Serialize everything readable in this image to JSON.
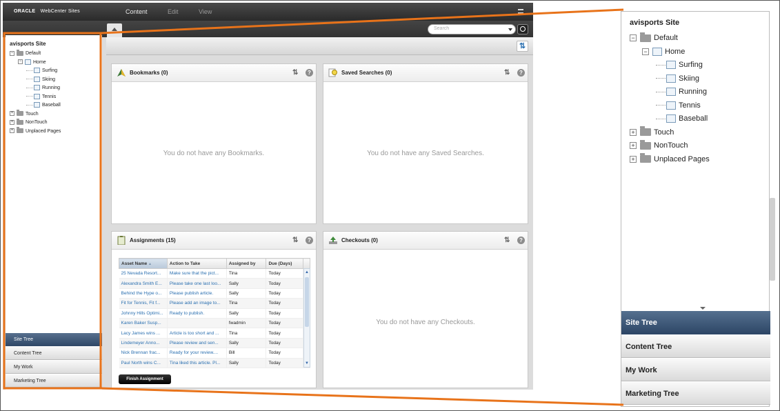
{
  "header": {
    "brand_oracle": "ORACLE",
    "brand_product": "WebCenter Sites",
    "nav": [
      "Content",
      "Edit",
      "View"
    ]
  },
  "search": {
    "placeholder": "Search"
  },
  "site_tree": {
    "title": "avisports Site",
    "nodes": [
      {
        "label": "Default",
        "level": 0,
        "type": "folder",
        "expander": "−"
      },
      {
        "label": "Home",
        "level": 1,
        "type": "page",
        "expander": "−"
      },
      {
        "label": "Surfing",
        "level": 2,
        "type": "page"
      },
      {
        "label": "Skiing",
        "level": 2,
        "type": "page"
      },
      {
        "label": "Running",
        "level": 2,
        "type": "page"
      },
      {
        "label": "Tennis",
        "level": 2,
        "type": "page"
      },
      {
        "label": "Baseball",
        "level": 2,
        "type": "page"
      },
      {
        "label": "Touch",
        "level": 0,
        "type": "folder",
        "expander": "+"
      },
      {
        "label": "NonTouch",
        "level": 0,
        "type": "folder",
        "expander": "+"
      },
      {
        "label": "Unplaced Pages",
        "level": 0,
        "type": "folder",
        "expander": "+"
      }
    ]
  },
  "accordion": [
    "Site Tree",
    "Content Tree",
    "My Work",
    "Marketing Tree"
  ],
  "panels": {
    "bookmarks": {
      "title": "Bookmarks (0)",
      "empty": "You do not have any Bookmarks."
    },
    "saved_searches": {
      "title": "Saved Searches (0)",
      "empty": "You do not have any Saved Searches."
    },
    "assignments": {
      "title": "Assignments (15)",
      "finish_label": "Finish Assignment"
    },
    "checkouts": {
      "title": "Checkouts (0)",
      "empty": "You do not have any Checkouts."
    }
  },
  "assignments_table": {
    "columns": [
      "Asset Name",
      "Action to Take",
      "Assigned by",
      "Due (Days)"
    ],
    "rows": [
      [
        "25 Nevada Resort...",
        "Make sure that the pict...",
        "Tina",
        "Today"
      ],
      [
        "Alexandra Smith E...",
        "Please take one last loo...",
        "Sally",
        "Today"
      ],
      [
        "Behind the Hype o...",
        "Please publish article.",
        "Sally",
        "Today"
      ],
      [
        "Fit for Tennis, Fit f...",
        "Please add an image to...",
        "Tina",
        "Today"
      ],
      [
        "Johnny Hills Optimi...",
        "Ready to publish.",
        "Sally",
        "Today"
      ],
      [
        "Karen Baker Susp...",
        "",
        "fwadmin",
        "Today"
      ],
      [
        "Lacy James wins ...",
        "Article is too short and ...",
        "Tina",
        "Today"
      ],
      [
        "Lindemeyer Anno...",
        "Please review and sen...",
        "Sally",
        "Today"
      ],
      [
        "Nick Brennan frac...",
        "Ready for your review....",
        "Bill",
        "Today"
      ],
      [
        "Paul North wins C...",
        "Tina liked this article. Pl...",
        "Sally",
        "Today"
      ]
    ]
  },
  "icons": {
    "refresh": "⇅",
    "help": "?",
    "scroll_up": "▲",
    "scroll_down": "▼",
    "sort": "▲"
  },
  "colors": {
    "accent": "#E8731A",
    "selected_tab": "#3A5272",
    "link": "#2A6FB0"
  }
}
